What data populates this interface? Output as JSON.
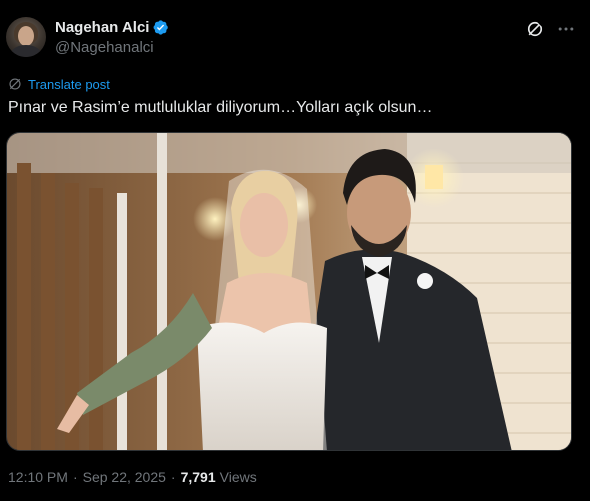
{
  "author": {
    "display_name": "Nagehan Alci",
    "handle": "@Nagehanalci",
    "verified": true
  },
  "icons": {
    "verified": "verified-badge-icon",
    "grok": "grok-icon",
    "more": "more-icon",
    "translate": "globe-icon"
  },
  "translate": {
    "label": "Translate post"
  },
  "tweet": {
    "text": "Pınar ve Rasim’e mutluluklar diliyorum…Yolları açık olsun…"
  },
  "media": {
    "alt": "Wedding photo of a bride in a white strapless gown and veil beside a groom in a black tuxedo with bow tie"
  },
  "meta": {
    "time": "12:10 PM",
    "date": "Sep 22, 2025",
    "separator": "·",
    "views_count": "7,791",
    "views_label": "Views"
  },
  "colors": {
    "background": "#000000",
    "text": "#e7e9ea",
    "muted": "#71767b",
    "accent": "#1d9bf0"
  }
}
